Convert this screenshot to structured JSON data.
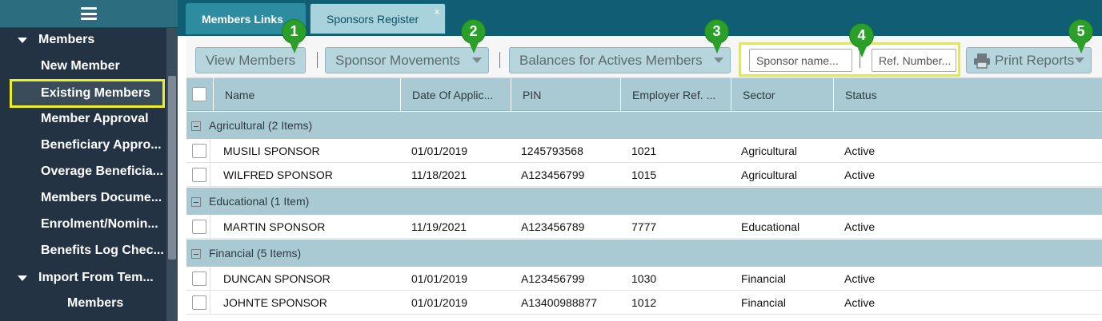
{
  "sidebar": {
    "items": [
      {
        "label": "Members",
        "type": "group"
      },
      {
        "label": "New Member",
        "type": "sub"
      },
      {
        "label": "Existing Members",
        "type": "sub",
        "selected": true
      },
      {
        "label": "Member Approval",
        "type": "sub"
      },
      {
        "label": "Beneficiary Appro...",
        "type": "sub"
      },
      {
        "label": "Overage Beneficia...",
        "type": "sub"
      },
      {
        "label": "Members Docume...",
        "type": "sub"
      },
      {
        "label": "Enrolment/Nomin...",
        "type": "sub"
      },
      {
        "label": "Benefits Log Chec...",
        "type": "sub"
      },
      {
        "label": "Import From Tem...",
        "type": "group"
      },
      {
        "label": "Members",
        "type": "sub2"
      }
    ]
  },
  "tabs": [
    {
      "label": "Members Links",
      "active": true
    },
    {
      "label": "Sponsors Register",
      "active": false,
      "close": "×"
    }
  ],
  "toolbar": {
    "view_members": "View Members",
    "sponsor_movements": "Sponsor Movements",
    "balances": "Balances for Actives Members",
    "sponsor_name_placeholder": "Sponsor name...",
    "ref_number_placeholder": "Ref. Number...",
    "print_reports": "Print Reports",
    "print_icon": "printer-icon"
  },
  "badges": [
    "1",
    "2",
    "3",
    "4",
    "5"
  ],
  "table": {
    "columns": [
      "Name",
      "Date Of Applic...",
      "PIN",
      "Employer Ref. ...",
      "Sector",
      "Status"
    ],
    "groups": [
      {
        "label": "Agricultural (2 Items)",
        "rows": [
          [
            "MUSILI SPONSOR",
            "01/01/2019",
            "1245793568",
            "1021",
            "Agricultural",
            "Active"
          ],
          [
            "WILFRED SPONSOR",
            "11/18/2021",
            "A123456799",
            "1015",
            "Agricultural",
            "Active"
          ]
        ]
      },
      {
        "label": "Educational (1 Item)",
        "rows": [
          [
            "MARTIN SPONSOR",
            "11/19/2021",
            "A123456789",
            "7777",
            "Educational",
            "Active"
          ]
        ]
      },
      {
        "label": "Financial (5 Items)",
        "rows": [
          [
            "DUNCAN SPONSOR",
            "01/01/2019",
            "A123456799",
            "1030",
            "Financial",
            "Active"
          ],
          [
            "JOHNTE SPONSOR",
            "01/01/2019",
            "A13400988877",
            "1012",
            "Financial",
            "Active"
          ]
        ]
      }
    ]
  },
  "colors": {
    "sidebar_bg": "#233343",
    "tabbar_bg": "#0f5e73",
    "highlight": "#f0f01c",
    "badge_green": "#2aa02a",
    "header_bg": "#a9cad3"
  }
}
